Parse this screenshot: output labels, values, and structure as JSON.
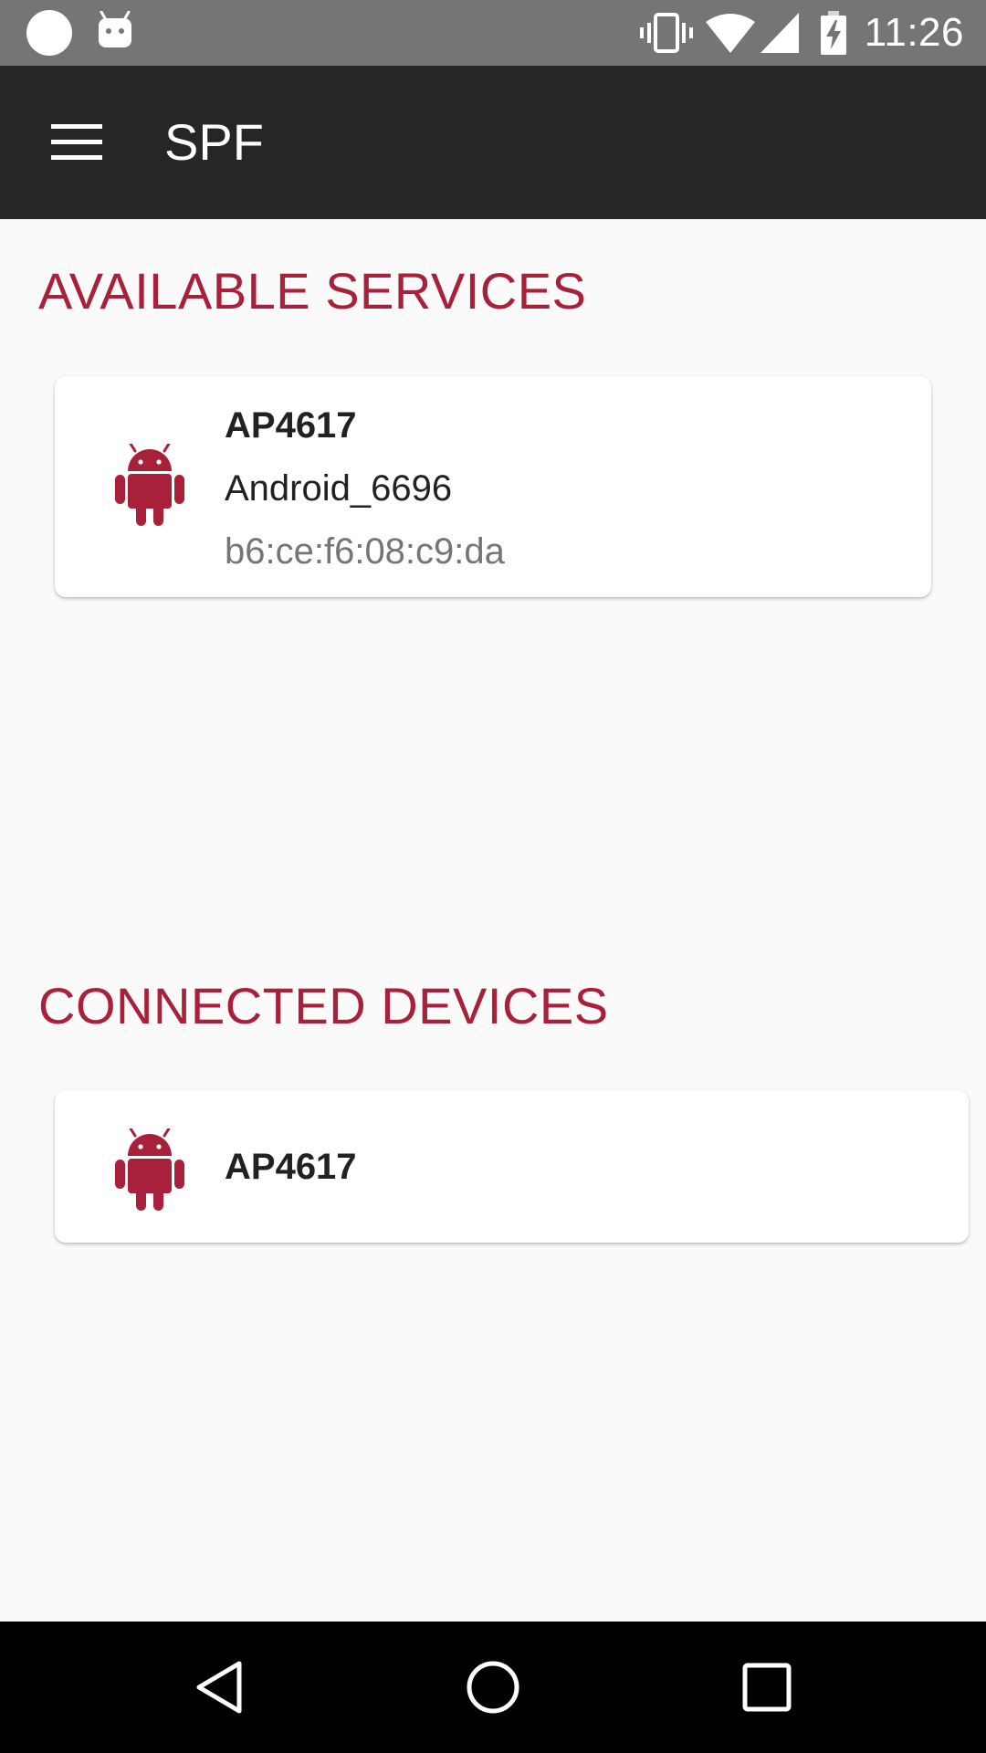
{
  "status_bar": {
    "time": "11:26",
    "left_icons": [
      "circle-notification-icon",
      "android-notification-icon"
    ],
    "right_icons": [
      "vibrate-icon",
      "wifi-icon",
      "cell-signal-icon",
      "battery-charging-icon"
    ]
  },
  "app_bar": {
    "menu_icon": "hamburger-menu-icon",
    "title": "SPF"
  },
  "available_services": {
    "heading": "AVAILABLE SERVICES",
    "items": [
      {
        "icon": "android-robot-icon",
        "name": "AP4617",
        "device": "Android_6696",
        "mac": "b6:ce:f6:08:c9:da"
      }
    ]
  },
  "connected_devices": {
    "heading": "CONNECTED DEVICES",
    "items": [
      {
        "icon": "android-robot-icon",
        "name": "AP4617"
      }
    ]
  },
  "nav_bar": {
    "buttons": [
      "back-icon",
      "home-icon",
      "recents-icon"
    ]
  },
  "colors": {
    "accent": "#a8203a",
    "app_bar": "#262626",
    "status_bar": "#757575",
    "background": "#fafafa"
  }
}
